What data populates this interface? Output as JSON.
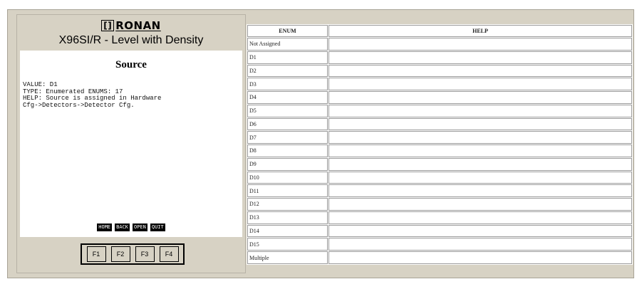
{
  "brand": {
    "logo_mark": "[]",
    "logo_text": "RONAN"
  },
  "device": {
    "model": "X96SI/R - Level with Density"
  },
  "param": {
    "title": "Source",
    "value_line": "VALUE: D1",
    "type_line": "TYPE: Enumerated ENUMS: 17",
    "help_line1": "HELP: Source is assigned in Hardware",
    "help_line2": "Cfg->Detectors->Detector Cfg."
  },
  "nav": {
    "home": "HOME",
    "back": "BACK",
    "open": "OPEN",
    "quit": "QUIT"
  },
  "fkeys": [
    "F1",
    "F2",
    "F3",
    "F4"
  ],
  "table": {
    "headers": [
      "ENUM",
      "HELP"
    ],
    "rows": [
      {
        "enum": "Not Assigned",
        "help": ""
      },
      {
        "enum": "D1",
        "help": ""
      },
      {
        "enum": "D2",
        "help": ""
      },
      {
        "enum": "D3",
        "help": ""
      },
      {
        "enum": "D4",
        "help": ""
      },
      {
        "enum": "D5",
        "help": ""
      },
      {
        "enum": "D6",
        "help": ""
      },
      {
        "enum": "D7",
        "help": ""
      },
      {
        "enum": "D8",
        "help": ""
      },
      {
        "enum": "D9",
        "help": ""
      },
      {
        "enum": "D10",
        "help": ""
      },
      {
        "enum": "D11",
        "help": ""
      },
      {
        "enum": "D12",
        "help": ""
      },
      {
        "enum": "D13",
        "help": ""
      },
      {
        "enum": "D14",
        "help": ""
      },
      {
        "enum": "D15",
        "help": ""
      },
      {
        "enum": "Multiple",
        "help": ""
      }
    ]
  }
}
